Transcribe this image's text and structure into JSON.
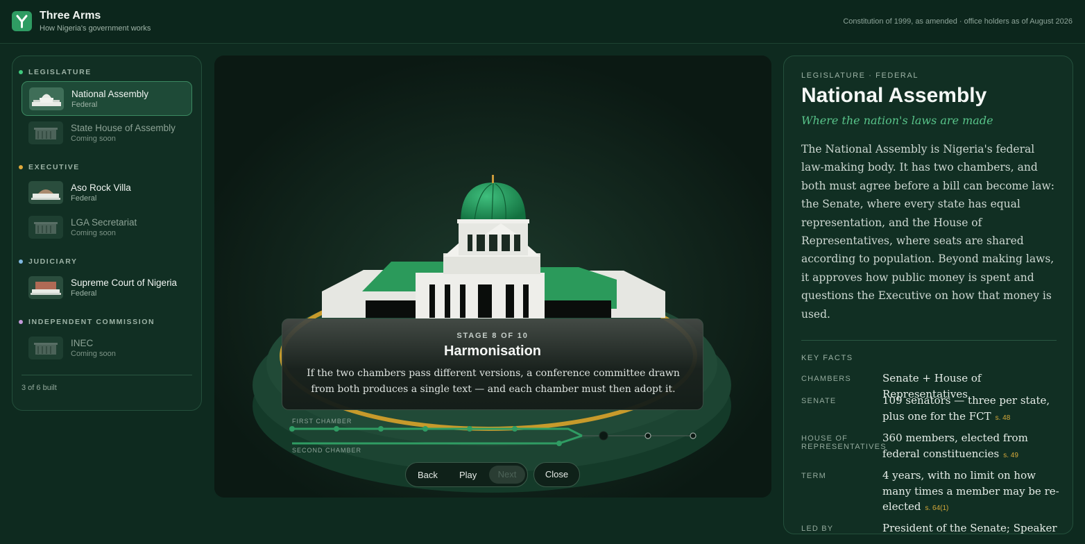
{
  "app": {
    "title": "Three Arms",
    "subtitle": "How Nigeria's government works",
    "note": "Constitution of 1999, as amended · office holders as of August 2026"
  },
  "colors": {
    "background": "#0e2a1f",
    "accent_green": "#2f9c63",
    "legislature_dot": "#3fc97c",
    "executive_dot": "#e0a93c",
    "judiciary_dot": "#7fb7e0",
    "commission_dot": "#c39ad9",
    "gold": "#d5a93a"
  },
  "sidebar": {
    "sections": [
      {
        "label": "LEGISLATURE",
        "items": [
          {
            "name": "National Assembly",
            "tag": "Federal",
            "thumb_icon": "dome-building-icon",
            "active": true
          },
          {
            "name": "State House of Assembly",
            "tag": "Coming soon",
            "thumb_icon": "building-icon"
          }
        ]
      },
      {
        "label": "EXECUTIVE",
        "items": [
          {
            "name": "Aso Rock Villa",
            "tag": "Federal",
            "thumb_icon": "villa-icon"
          },
          {
            "name": "LGA Secretariat",
            "tag": "Coming soon",
            "thumb_icon": "building-icon"
          }
        ]
      },
      {
        "label": "JUDICIARY",
        "items": [
          {
            "name": "Supreme Court of Nigeria",
            "tag": "Federal",
            "thumb_icon": "court-icon"
          }
        ]
      },
      {
        "label": "INDEPENDENT COMMISSION",
        "items": [
          {
            "name": "INEC",
            "tag": "Coming soon",
            "thumb_icon": "building-icon"
          }
        ]
      }
    ],
    "count": "3 of 6 built"
  },
  "stage": {
    "kicker": "STAGE 8 OF 10",
    "title": "Harmonisation",
    "body": "If the two chambers pass different versions, a conference committee drawn from both produces a single text — and each chamber must then adopt it.",
    "track_first": "FIRST CHAMBER",
    "track_second": "SECOND CHAMBER",
    "current_stage": 8,
    "total_stages": 10,
    "controls": {
      "back": "Back",
      "play": "Play",
      "next": "Next",
      "close": "Close"
    }
  },
  "panel": {
    "kicker": "LEGISLATURE · FEDERAL",
    "title": "National Assembly",
    "tagline": "Where the nation's laws are made",
    "description": "The National Assembly is Nigeria's federal law-making body. It has two chambers, and both must agree before a bill can become law: the Senate, where every state has equal representation, and the House of Representatives, where seats are shared according to population. Beyond making laws, it approves how public money is spent and questions the Executive on how that money is used.",
    "facts_heading": "KEY FACTS",
    "facts": [
      {
        "key": "CHAMBERS",
        "value": "Senate + House of Representatives",
        "ref": ""
      },
      {
        "key": "SENATE",
        "value": "109 senators — three per state, plus one for the FCT",
        "ref": "s. 48"
      },
      {
        "key": "HOUSE OF REPRESENTATIVES",
        "value": "360 members, elected from federal constituencies",
        "ref": "s. 49"
      },
      {
        "key": "TERM",
        "value": "4 years, with no limit on how many times a member may be re-elected",
        "ref": "s. 64(1)"
      },
      {
        "key": "LED BY",
        "value": "President of the Senate; Speaker of",
        "ref": ""
      }
    ]
  }
}
